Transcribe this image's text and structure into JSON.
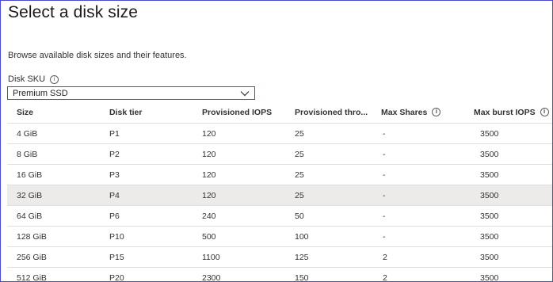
{
  "page": {
    "title": "Select a disk size",
    "description": "Browse available disk sizes and their features."
  },
  "sku": {
    "label": "Disk SKU",
    "info_icon": "info-icon",
    "selected": "Premium SSD"
  },
  "table": {
    "headers": [
      "Size",
      "Disk tier",
      "Provisioned IOPS",
      "Provisioned thro...",
      "Max Shares",
      "Max burst IOPS"
    ],
    "rows": [
      [
        "4 GiB",
        "P1",
        "120",
        "25",
        "-",
        "3500"
      ],
      [
        "8 GiB",
        "P2",
        "120",
        "25",
        "-",
        "3500"
      ],
      [
        "16 GiB",
        "P3",
        "120",
        "25",
        "-",
        "3500"
      ],
      [
        "32 GiB",
        "P4",
        "120",
        "25",
        "-",
        "3500"
      ],
      [
        "64 GiB",
        "P6",
        "240",
        "50",
        "-",
        "3500"
      ],
      [
        "128 GiB",
        "P10",
        "500",
        "100",
        "-",
        "3500"
      ],
      [
        "256 GiB",
        "P15",
        "1100",
        "125",
        "2",
        "3500"
      ],
      [
        "512 GiB",
        "P20",
        "2300",
        "150",
        "2",
        "3500"
      ]
    ],
    "selected_row": 3
  },
  "colors": {
    "frame_border": "#4b4bd0",
    "dropdown_border": "#0f6cbd",
    "selected_row_bg": "#edebe9",
    "row_divider": "#e1dfdd"
  }
}
